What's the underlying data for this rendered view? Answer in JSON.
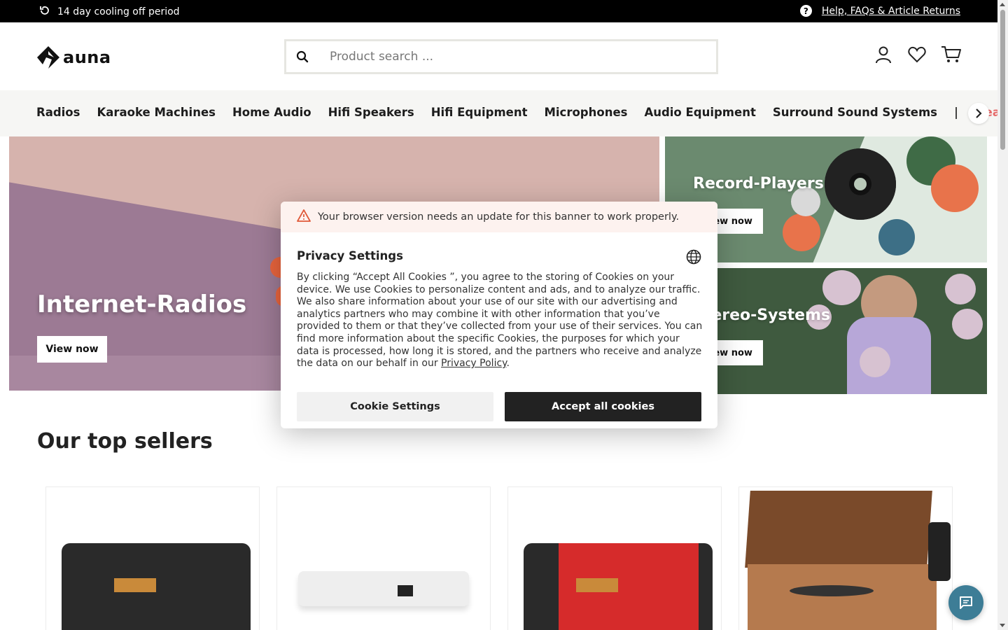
{
  "topbar": {
    "cooling_off": "14 day cooling off period",
    "help_link": "Help, FAQs & Article Returns"
  },
  "header": {
    "logo_text": "auna",
    "search_placeholder": "Product search ..."
  },
  "nav": {
    "items": [
      "Radios",
      "Karaoke Machines",
      "Home Audio",
      "Hifi Speakers",
      "Hifi Equipment",
      "Microphones",
      "Audio Equipment",
      "Surround Sound Systems"
    ],
    "separator": "|",
    "deals": "Deals"
  },
  "hero": {
    "main_title": "Internet-Radios",
    "main_button": "View now",
    "side_top_title": "Record-Players",
    "side_top_button": "View now",
    "side_bottom_title": "Stereo-Systems",
    "side_bottom_button": "View now"
  },
  "sellers": {
    "title": "Our top sellers"
  },
  "cookie_modal": {
    "warning": "Your browser version needs an update for this banner to work properly.",
    "title": "Privacy Settings",
    "description": "By clicking “Accept All Cookies ”, you agree to the storing of Cookies on your device. We use Cookies to personalize content and ads, and to analyze our traffic. We also share information about your use of our site with our advertising and analytics partners who may combine it with other information that you’ve provided to them or that they’ve collected from your use of their services. You can find more information about the specific Cookies, the purposes for which your data is processed, how long it is stored, and the partners who receive and analyze the data on our behalf in our",
    "privacy_link": "Privacy Policy",
    "settings_button": "Cookie Settings",
    "accept_button": "Accept all cookies"
  },
  "colors": {
    "deals": "#e66b6b",
    "accept_bg": "#222222",
    "chat_bg": "#3d7d96"
  }
}
